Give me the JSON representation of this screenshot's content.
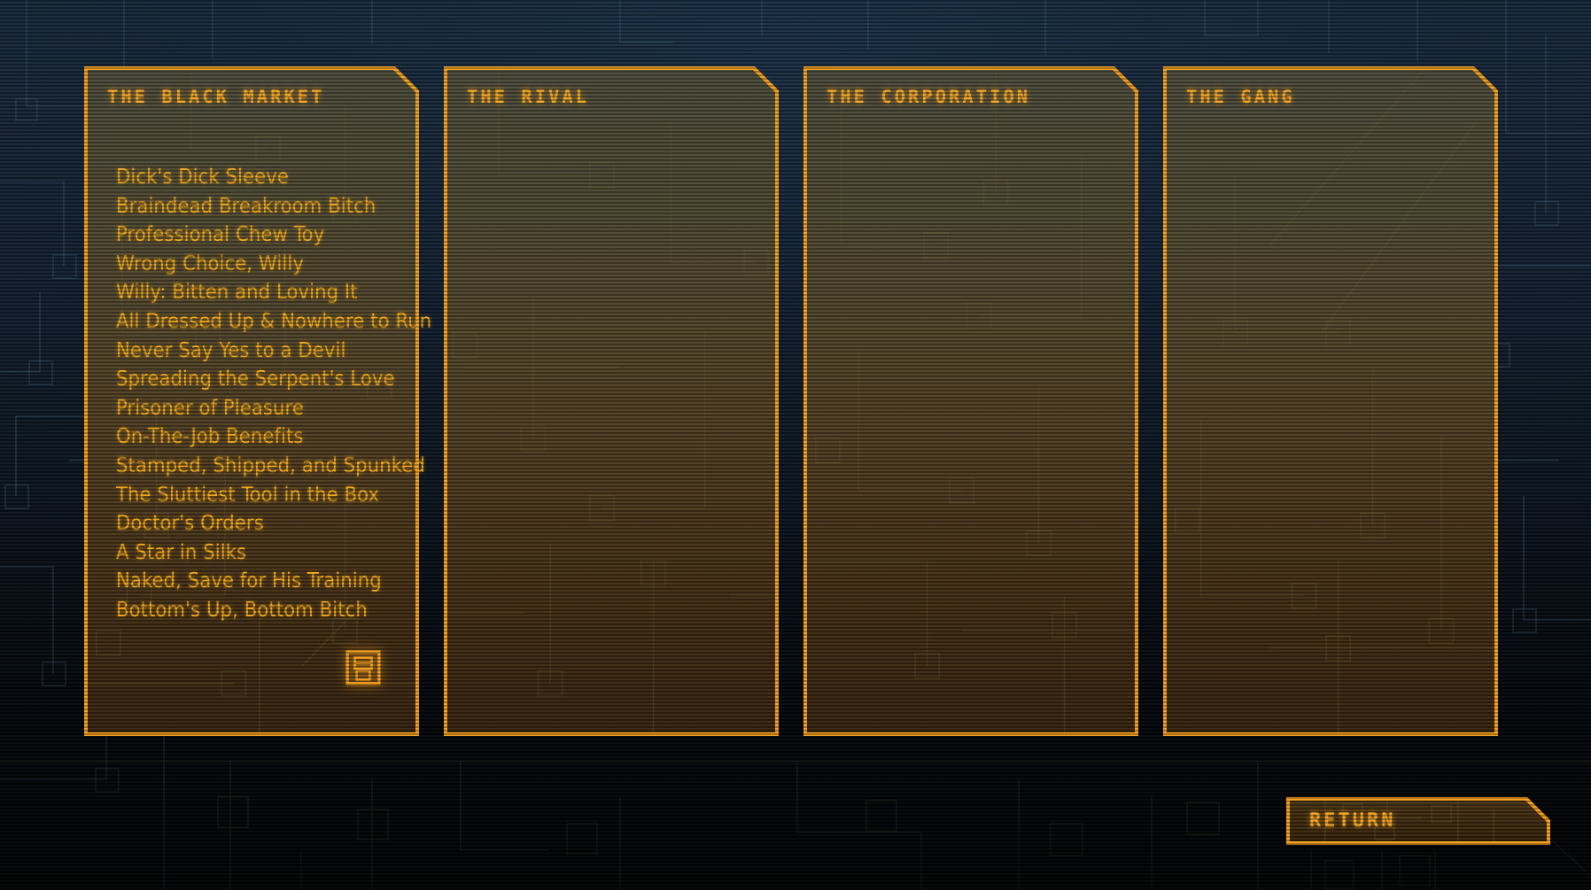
{
  "screen": {
    "accent_color": "#f7a01c",
    "text_color": "#f0a81a",
    "background_color": "#0d1824"
  },
  "panels": [
    {
      "title": "THE BLACK MARKET",
      "items": [
        "Dick's Dick Sleeve",
        "Braindead Breakroom Bitch",
        "Professional Chew Toy",
        "Wrong Choice, Willy",
        "Willy: Bitten and Loving It",
        "All Dressed Up & Nowhere to Run",
        "Never Say Yes to a Devil",
        "Spreading the Serpent's Love",
        "Prisoner of Pleasure",
        "On-The-Job Benefits",
        "Stamped, Shipped, and Spunked",
        "The Sluttiest Tool in the Box",
        "Doctor's Orders",
        "A Star in Silks",
        "Naked, Save for His Training",
        "Bottom's Up, Bottom Bitch"
      ],
      "icon": "save-floppy-icon"
    },
    {
      "title": "THE RIVAL",
      "items": []
    },
    {
      "title": "THE CORPORATION",
      "items": []
    },
    {
      "title": "THE GANG",
      "items": []
    }
  ],
  "return_button": {
    "label": "RETURN"
  }
}
